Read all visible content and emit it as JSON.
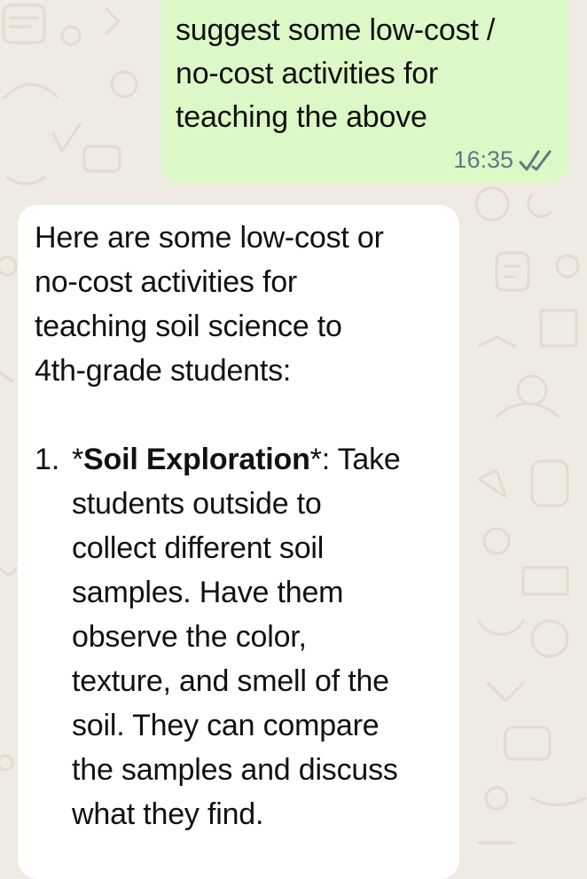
{
  "outgoing_message": {
    "text": "suggest some low-cost /\nno-cost activities for\nteaching the above",
    "time": "16:35",
    "status_icon": "double-check-icon",
    "bubble_color": "#dcf8c6"
  },
  "incoming_message": {
    "intro": "Here are some low-cost or\nno-cost activities for\nteaching soil science to\n4th-grade students:",
    "items": [
      {
        "number": "1.",
        "prefix": "*",
        "title": "Soil Exploration",
        "suffix": "*: Take",
        "body": "students outside to\ncollect different soil\nsamples. Have them\nobserve the color,\ntexture, and smell of the\nsoil. They can compare\nthe samples and discuss\nwhat they find."
      }
    ],
    "bubble_color": "#ffffff"
  },
  "theme": {
    "background": "#efeae2",
    "meta_text_color": "#667781"
  }
}
